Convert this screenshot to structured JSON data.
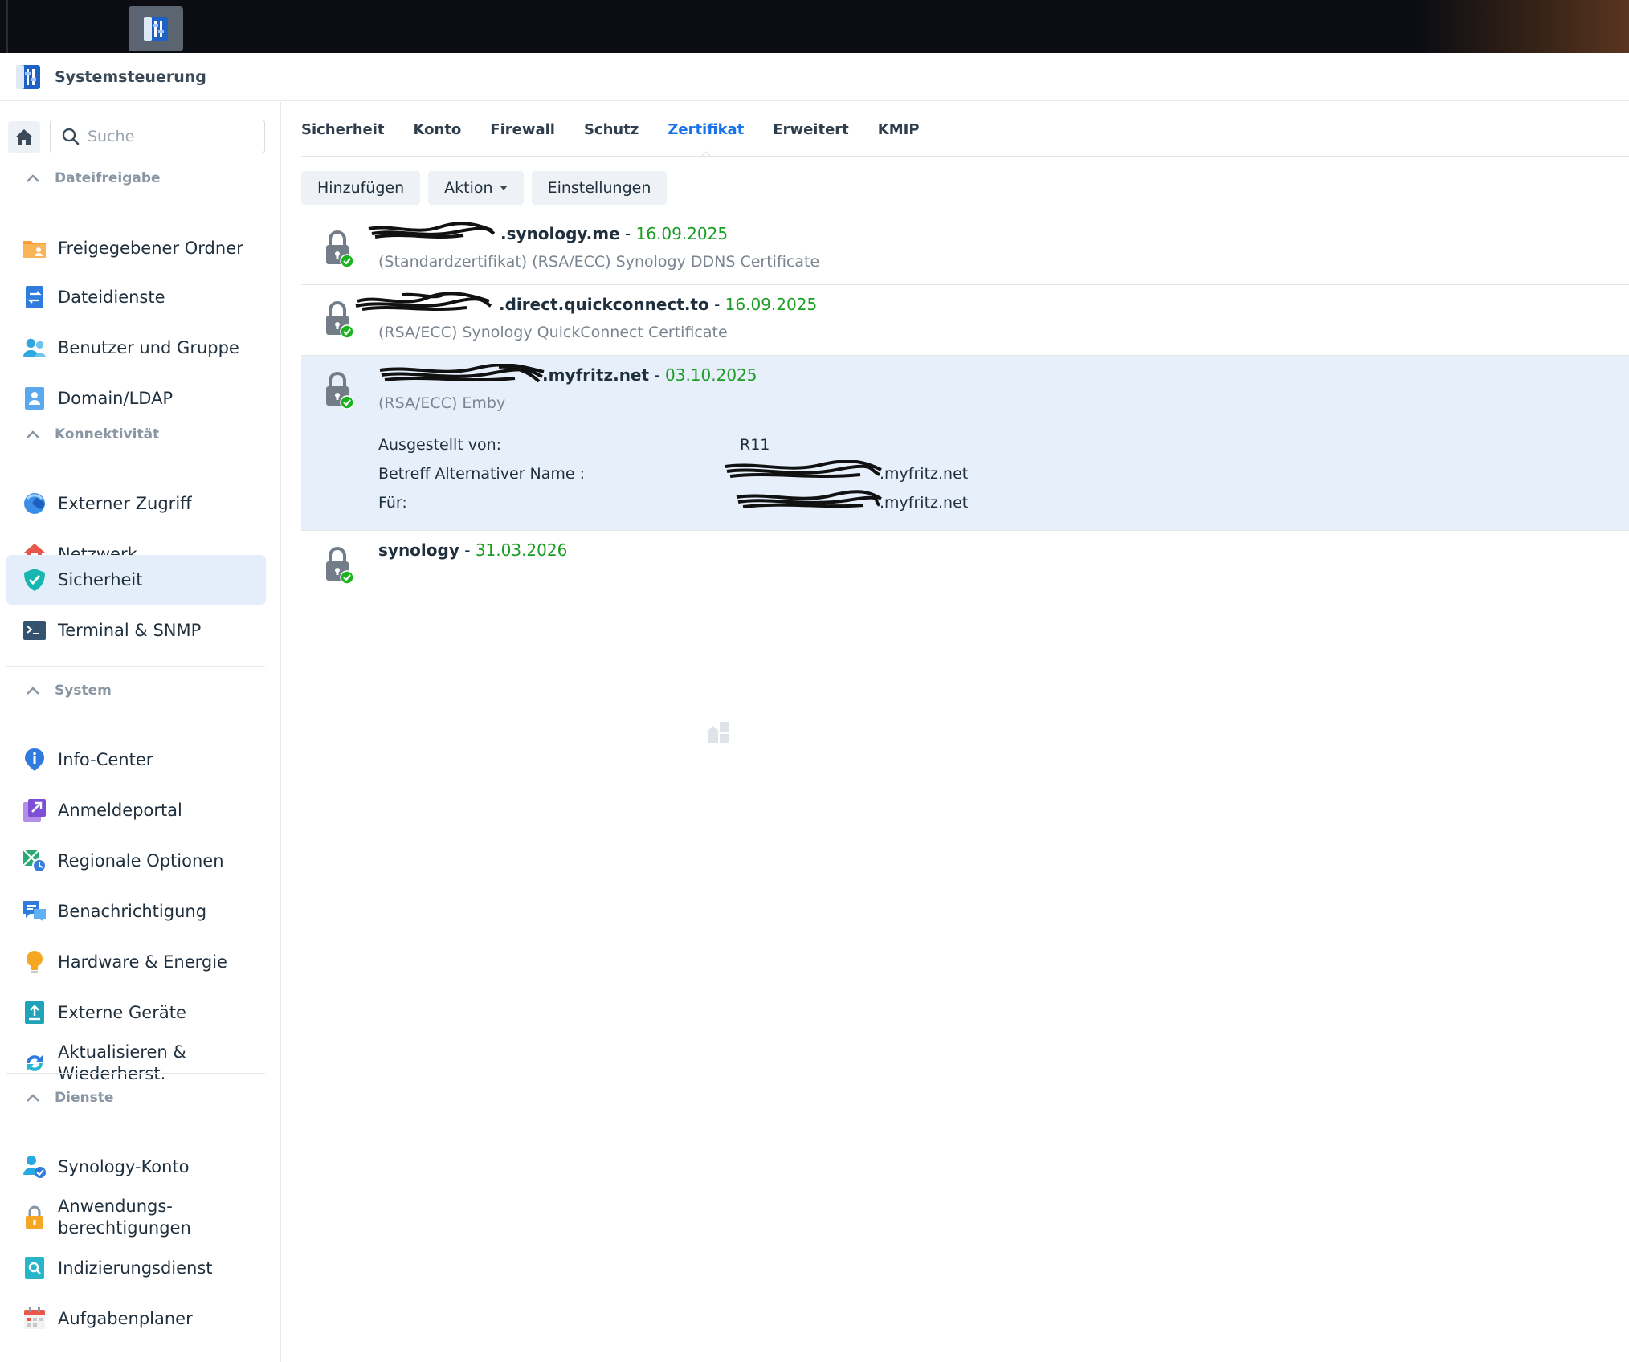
{
  "window": {
    "title": "Systemsteuerung"
  },
  "taskbar": {
    "main_menu_icon": "grid-icon",
    "app_icon": "control-panel-icon"
  },
  "sidebar": {
    "search_placeholder": "Suche",
    "sections": [
      {
        "title": "Dateifreigabe",
        "items": [
          {
            "label": "Freigegebener Ordner",
            "icon": "shared-folder-icon"
          },
          {
            "label": "Dateidienste",
            "icon": "file-services-icon"
          },
          {
            "label": "Benutzer und Gruppe",
            "icon": "users-icon"
          },
          {
            "label": "Domain/LDAP",
            "icon": "domain-icon"
          }
        ]
      },
      {
        "title": "Konnektivität",
        "items": [
          {
            "label": "Externer Zugriff",
            "icon": "external-access-icon"
          },
          {
            "label": "Netzwerk",
            "icon": "network-icon"
          },
          {
            "label": "Sicherheit",
            "icon": "security-shield-icon",
            "active": true
          },
          {
            "label": "Terminal & SNMP",
            "icon": "terminal-icon"
          }
        ]
      },
      {
        "title": "System",
        "items": [
          {
            "label": "Info-Center",
            "icon": "info-icon"
          },
          {
            "label": "Anmeldeportal",
            "icon": "login-portal-icon"
          },
          {
            "label": "Regionale Optionen",
            "icon": "regional-options-icon"
          },
          {
            "label": "Benachrichtigung",
            "icon": "notification-icon"
          },
          {
            "label": "Hardware & Energie",
            "icon": "hardware-power-icon"
          },
          {
            "label": "Externe Geräte",
            "icon": "external-devices-icon"
          },
          {
            "label": "Aktualisieren & Wiederherst.",
            "line1": "Aktualisieren &",
            "line2": "Wiederherst.",
            "icon": "update-restore-icon"
          }
        ]
      },
      {
        "title": "Dienste",
        "items": [
          {
            "label": "Synology-Konto",
            "icon": "synology-account-icon"
          },
          {
            "label": "Anwendungs-berechtigungen",
            "line1": "Anwendungs-",
            "line2": "berechtigungen",
            "icon": "app-privileges-icon"
          },
          {
            "label": "Indizierungsdienst",
            "icon": "indexing-icon"
          },
          {
            "label": "Aufgabenplaner",
            "icon": "task-scheduler-icon"
          }
        ]
      }
    ]
  },
  "tabs": [
    "Sicherheit",
    "Konto",
    "Firewall",
    "Schutz",
    "Zertifikat",
    "Erweitert",
    "KMIP"
  ],
  "active_tab": "Zertifikat",
  "toolbar": {
    "add": "Hinzufügen",
    "action": "Aktion",
    "settings": "Einstellungen"
  },
  "certificates": [
    {
      "name": ".synology.me",
      "separator": "-",
      "date": "16.09.2025",
      "description": "(Standardzertifikat) (RSA/ECC) Synology DDNS Certificate"
    },
    {
      "name": ".direct.quickconnect.to",
      "separator": "-",
      "date": "16.09.2025",
      "description": "(RSA/ECC) Synology QuickConnect Certificate"
    },
    {
      "name": ".myfritz.net",
      "separator": "-",
      "date": "03.10.2025",
      "description": "(RSA/ECC) Emby",
      "details": {
        "issuer_label": "Ausgestellt von:",
        "issuer_value": "R11",
        "san_label": "Betreff Alternativer Name :",
        "san_value": ".myfritz.net",
        "for_label": "Für:",
        "for_value": ".myfritz.net"
      }
    },
    {
      "name": "synology",
      "separator": "-",
      "date": "31.03.2026",
      "description": ""
    }
  ],
  "colors": {
    "accent": "#1a73e8",
    "valid_date": "#1b9c24",
    "selected_row": "#e6effa",
    "active_nav": "#e4eefb"
  }
}
